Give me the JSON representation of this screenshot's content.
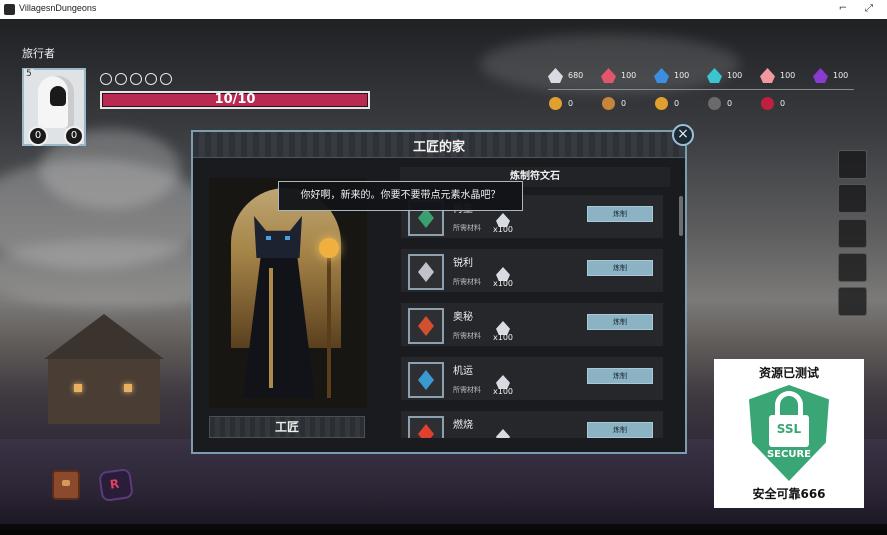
{
  "window": {
    "title": "VillagesnDungeons",
    "minimize": "⌐",
    "maximize": "⤢"
  },
  "player": {
    "name": "旅行者",
    "level": "5",
    "attack": "0",
    "defense": "0",
    "stars_count": 5,
    "hp_text": "10/10",
    "hp_fraction": 1.0,
    "hp_color": "#b82a52"
  },
  "resources": {
    "crystals": [
      {
        "icon": "white-crystal-icon",
        "color": "#d8dce2",
        "value": "680"
      },
      {
        "icon": "red-crystal-icon",
        "color": "#e0566a",
        "value": "100"
      },
      {
        "icon": "blue-crystal-icon",
        "color": "#3a8fe0",
        "value": "100"
      },
      {
        "icon": "cyan-crystal-icon",
        "color": "#3cc4d0",
        "value": "100"
      },
      {
        "icon": "pink-crystal-icon",
        "color": "#f09aa0",
        "value": "100"
      },
      {
        "icon": "purple-crystal-icon",
        "color": "#8a3ad0",
        "value": "100"
      }
    ],
    "items": [
      {
        "icon": "gold-ore-icon",
        "color": "#e0a030",
        "value": "0"
      },
      {
        "icon": "scroll-icon",
        "color": "#c8843a",
        "value": "0"
      },
      {
        "icon": "gold-coin-icon",
        "color": "#e0a030",
        "value": "0"
      },
      {
        "icon": "skull-icon",
        "color": "#6a6a6a",
        "value": "0"
      },
      {
        "icon": "red-rune-icon",
        "color": "#c02040",
        "value": "0"
      }
    ]
  },
  "dialog": {
    "title": "工匠的家",
    "close": "×",
    "npc_label": "工匠",
    "speech": "你好啊，新来的。你要不要带点元素水晶吧？",
    "list_header": "炼制符文石",
    "recipes": [
      {
        "name": "再生",
        "requirement": "所需材料",
        "qty": "x100",
        "button": "炼制",
        "color": "#3aa070"
      },
      {
        "name": "锐利",
        "requirement": "所需材料",
        "qty": "x100",
        "button": "炼制",
        "color": "#c0c4ca"
      },
      {
        "name": "奥秘",
        "requirement": "所需材料",
        "qty": "x100",
        "button": "炼制",
        "color": "#d05030"
      },
      {
        "name": "机运",
        "requirement": "所需材料",
        "qty": "x100",
        "button": "炼制",
        "color": "#3a9ad0"
      },
      {
        "name": "燃烧",
        "requirement": "所需材料",
        "qty": "",
        "button": "炼制",
        "color": "#e04030"
      }
    ]
  },
  "ssl_badge": {
    "top_text": "资源已测试",
    "ssl": "SSL",
    "secure": "SECURE",
    "bottom_text": "安全可靠666",
    "color": "#3aa676"
  }
}
